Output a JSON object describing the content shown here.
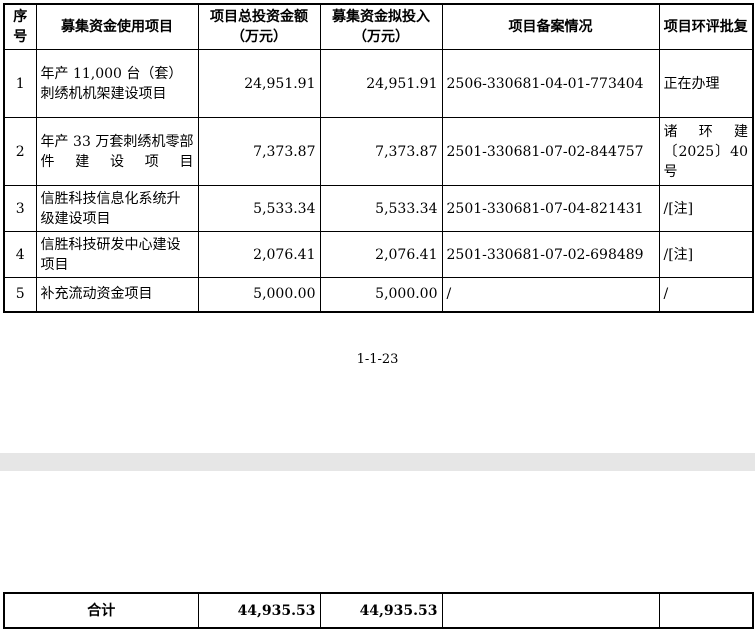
{
  "table": {
    "headers": [
      "序号",
      "募集资金使用项目",
      "项目总投资金额（万元）",
      "募集资金拟投入（万元）",
      "项目备案情况",
      "项目环评批复"
    ],
    "rows": [
      {
        "no": "1",
        "project": "年产 11,000 台（套）刺绣机机架建设项目",
        "total": "24,951.91",
        "raised": "24,951.91",
        "filing": "2506-330681-04-01-773404",
        "env": "正在办理"
      },
      {
        "no": "2",
        "project": "年产 33 万套刺绣机零部件建设项目",
        "total": "7,373.87",
        "raised": "7,373.87",
        "filing": "2501-330681-07-02-844757",
        "env": "诸环建〔2025〕40 号"
      },
      {
        "no": "3",
        "project": "信胜科技信息化系统升级建设项目",
        "total": "5,533.34",
        "raised": "5,533.34",
        "filing": "2501-330681-07-04-821431",
        "env": "/[注]"
      },
      {
        "no": "4",
        "project": "信胜科技研发中心建设项目",
        "total": "2,076.41",
        "raised": "2,076.41",
        "filing": "2501-330681-07-02-698489",
        "env": "/[注]"
      },
      {
        "no": "5",
        "project": "补充流动资金项目",
        "total": "5,000.00",
        "raised": "5,000.00",
        "filing": "/",
        "env": "/"
      }
    ]
  },
  "page_number": "1-1-23",
  "total_row": {
    "label": "合计",
    "total": "44,935.53",
    "raised": "44,935.53",
    "filing": "",
    "env": ""
  }
}
